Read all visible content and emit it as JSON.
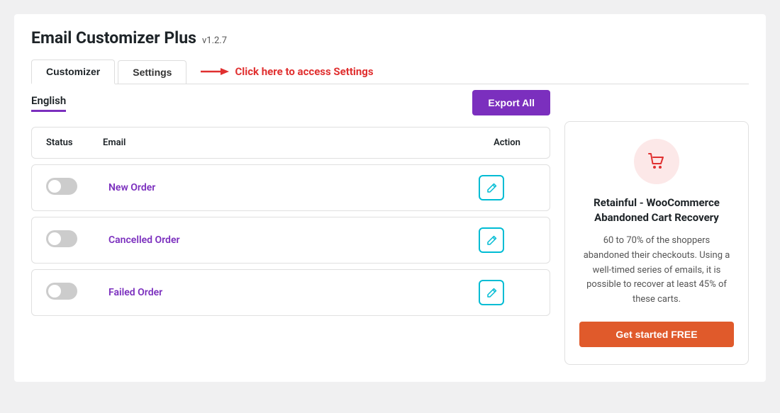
{
  "header": {
    "title": "Email Customizer Plus",
    "version": "v1.2.7"
  },
  "tabs": [
    {
      "id": "customizer",
      "label": "Customizer",
      "active": true
    },
    {
      "id": "settings",
      "label": "Settings",
      "active": false
    }
  ],
  "settings_hint": "Click here to access Settings",
  "language": {
    "label": "English"
  },
  "export_button": "Export All",
  "table": {
    "columns": {
      "status": "Status",
      "email": "Email",
      "action": "Action"
    },
    "rows": [
      {
        "id": "new-order",
        "name": "New Order",
        "enabled": false
      },
      {
        "id": "cancelled-order",
        "name": "Cancelled Order",
        "enabled": false
      },
      {
        "id": "failed-order",
        "name": "Failed Order",
        "enabled": false
      }
    ]
  },
  "promo": {
    "icon": "🛒",
    "title": "Retainful - WooCommerce Abandoned Cart Recovery",
    "description": "60 to 70% of the shoppers abandoned their checkouts. Using a well-timed series of emails, it is possible to recover at least 45% of these carts.",
    "cta": "Get started FREE"
  },
  "colors": {
    "purple": "#7b2fbe",
    "cyan": "#00bcd4",
    "orange": "#e05a2b",
    "red_arrow": "#e03030"
  }
}
